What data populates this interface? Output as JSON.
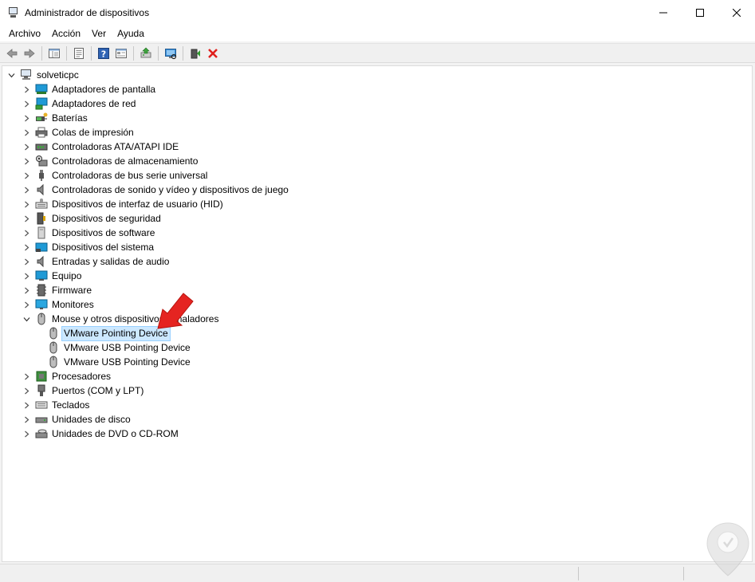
{
  "window": {
    "title": "Administrador de dispositivos",
    "controls": [
      "minimize",
      "maximize",
      "close"
    ]
  },
  "menu": [
    "Archivo",
    "Acción",
    "Ver",
    "Ayuda"
  ],
  "toolbar": {
    "buttons": [
      "back-icon",
      "forward-icon",
      "console-tree-icon",
      "properties-icon",
      "help-icon",
      "view-icon",
      "update-driver-icon",
      "scan-hardware-icon",
      "enable-device-icon",
      "uninstall-icon"
    ]
  },
  "tree": {
    "root": "solveticpc",
    "categories": [
      "Adaptadores de pantalla",
      "Adaptadores de red",
      "Baterías",
      "Colas de impresión",
      "Controladoras ATA/ATAPI IDE",
      "Controladoras de almacenamiento",
      "Controladoras de bus serie universal",
      "Controladoras de sonido y vídeo y dispositivos de juego",
      "Dispositivos de interfaz de usuario (HID)",
      "Dispositivos de seguridad",
      "Dispositivos de software",
      "Dispositivos del sistema",
      "Entradas y salidas de audio",
      "Equipo",
      "Firmware",
      "Monitores",
      "Mouse y otros dispositivos señaladores",
      "Procesadores",
      "Puertos (COM y LPT)",
      "Teclados",
      "Unidades de disco",
      "Unidades de DVD o CD-ROM"
    ],
    "mouse_children": [
      "VMware Pointing Device",
      "VMware USB Pointing Device",
      "VMware USB Pointing Device"
    ],
    "selected": "VMware Pointing Device"
  },
  "colors": {
    "selection": "#cce8ff",
    "selection_border": "#99d1ff",
    "annotation": "#e52421"
  }
}
